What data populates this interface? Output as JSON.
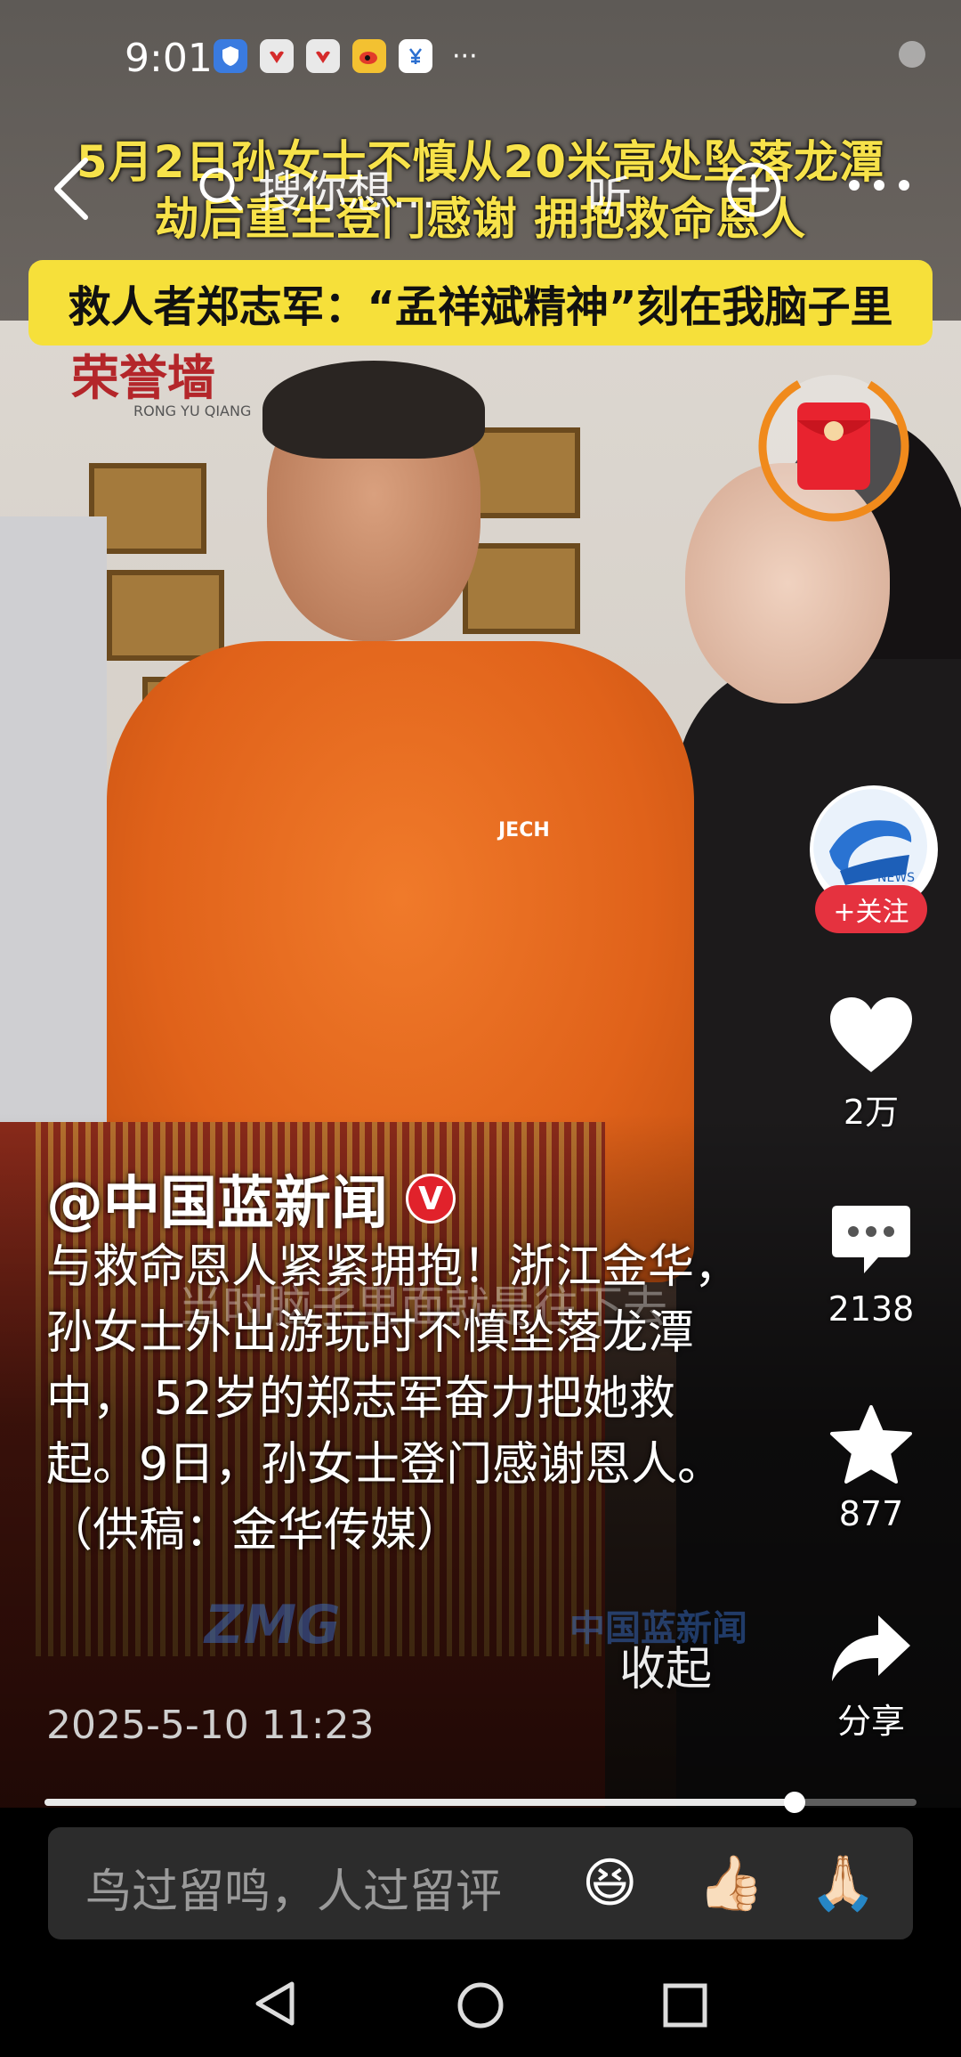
{
  "status_bar": {
    "time": "9:01",
    "icons": [
      "shield-app-icon",
      "huawei-app-icon",
      "huawei-app-icon-2",
      "weibo-icon",
      "finance-app-icon"
    ],
    "more": "···"
  },
  "headline": {
    "line1": "5月2日孙女士不慎从20米高处坠落龙潭",
    "line2": "劫后重生登门感谢  拥抱救命恩人",
    "sub": "救人者郑志军：“孟祥斌精神”刻在我脑子里"
  },
  "top_nav": {
    "search_text": "搜你想…",
    "listen_text": "听"
  },
  "scene": {
    "wall_text": "荣誉墙",
    "wall_text_small": "RONG YU QIANG",
    "shirt_logo": "JECH",
    "subtitle_overlay": "当时脑子里面就是往下去",
    "watermark1": "ZMG",
    "watermark2": "中国蓝新闻"
  },
  "author": {
    "name": "@中国蓝新闻",
    "badge": "V",
    "follow_label": "+关注",
    "avatar_text": "NEWS"
  },
  "actions": {
    "likes": "2万",
    "comments": "2138",
    "favorites": "877",
    "share_label": "分享"
  },
  "caption": {
    "text": "与救命恩人紧紧拥抱！浙江金华，孙女士外出游玩时不慎坠落龙潭中， 52岁的郑志军奋力把她救起。9日，孙女士登门感谢恩人。（供稿：金华传媒）",
    "collapse_label": "收起",
    "timestamp": "2025-5-10 11:23"
  },
  "progress": {
    "fraction": 0.86
  },
  "comment_bar": {
    "placeholder": "鸟过留鸣，人过留评",
    "emojis": [
      "😆",
      "👍🏻",
      "🙏🏻"
    ]
  },
  "colors": {
    "headline_yellow": "#f7e24a",
    "sub_bg": "#f6e03a",
    "follow_red": "#e5323f",
    "badge_red": "#e1222b",
    "redpacket_ring": "#f08a1c"
  }
}
